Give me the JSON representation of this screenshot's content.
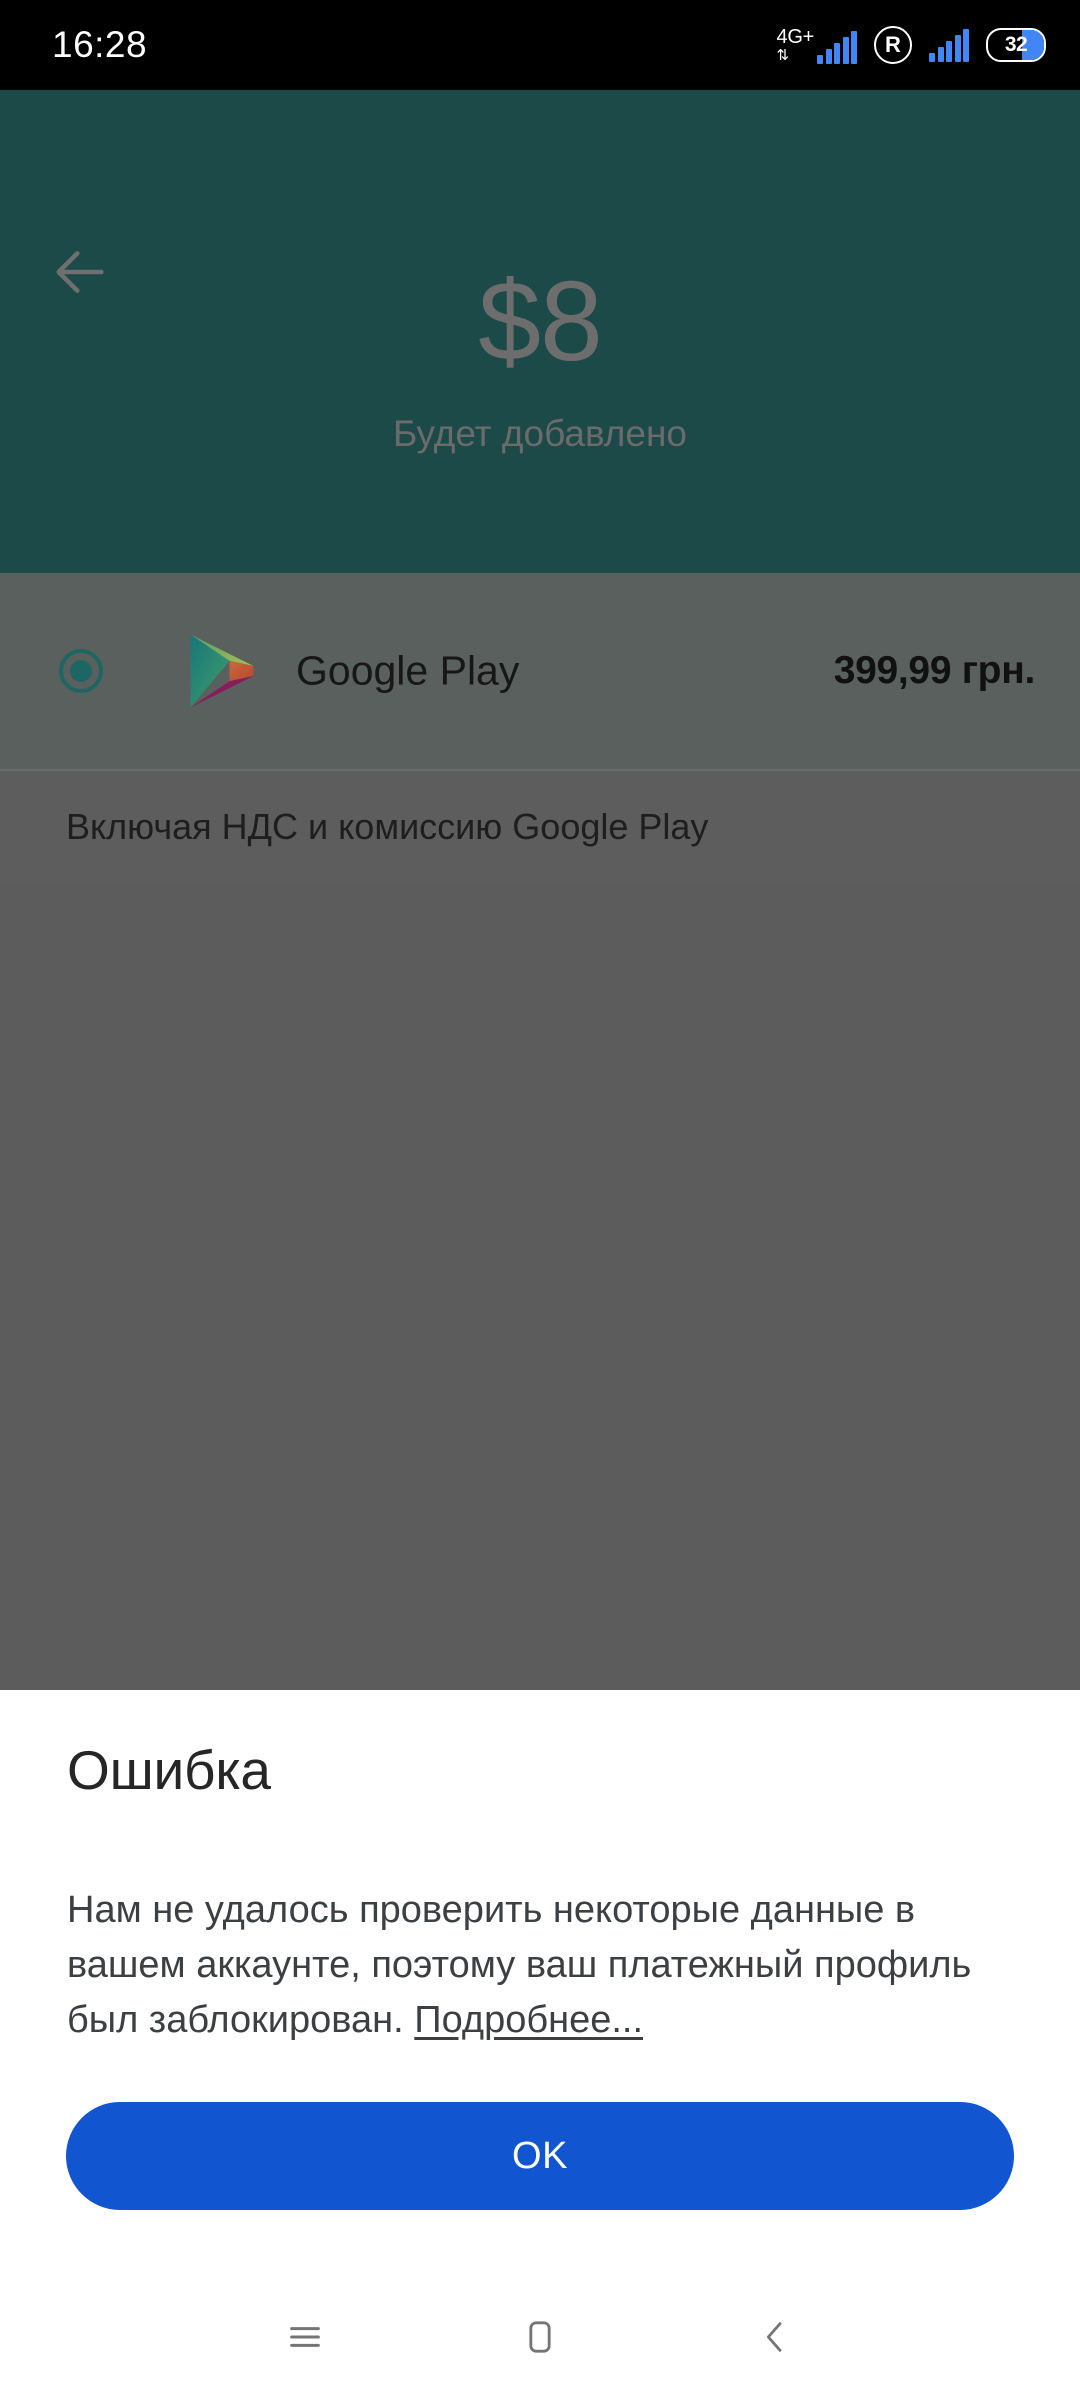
{
  "status_bar": {
    "time": "16:28",
    "network_type": "4G+",
    "data_arrows": "⇅",
    "roaming_label": "R",
    "battery_level": "32",
    "icons": [
      "signal-bars-icon",
      "roaming-icon",
      "signal-bars-icon",
      "battery-icon"
    ],
    "background_color": "#000000",
    "signal_color": "#4285f4"
  },
  "payment_screen": {
    "back_icon": "back-arrow-icon",
    "hero": {
      "amount": "$8",
      "caption": "Будет добавлено",
      "background_color": "#1c4a48"
    },
    "method": {
      "selected": true,
      "radio_icon": "radio-selected-icon",
      "logo_icon": "google-play-logo-icon",
      "name": "Google Play",
      "price": "399,99 грн.",
      "accent_color": "#1d6663"
    },
    "tax_note": "Включая НДС и комиссию Google Play",
    "scrim_color": "#5c5c5c"
  },
  "error_dialog": {
    "title": "Ошибка",
    "body_before_link": "Нам не удалось проверить некоторые данные в вашем аккаунте, поэтому ваш платежный профиль был заблокирован. ",
    "link_text": "Подробнее...",
    "ok_label": "OK",
    "ok_color": "#1155d0",
    "background_color": "#ffffff"
  },
  "nav_bar": {
    "recents_icon": "recents-menu-icon",
    "home_icon": "home-square-icon",
    "back_icon": "back-chevron-icon",
    "background_color": "#ffffff"
  }
}
